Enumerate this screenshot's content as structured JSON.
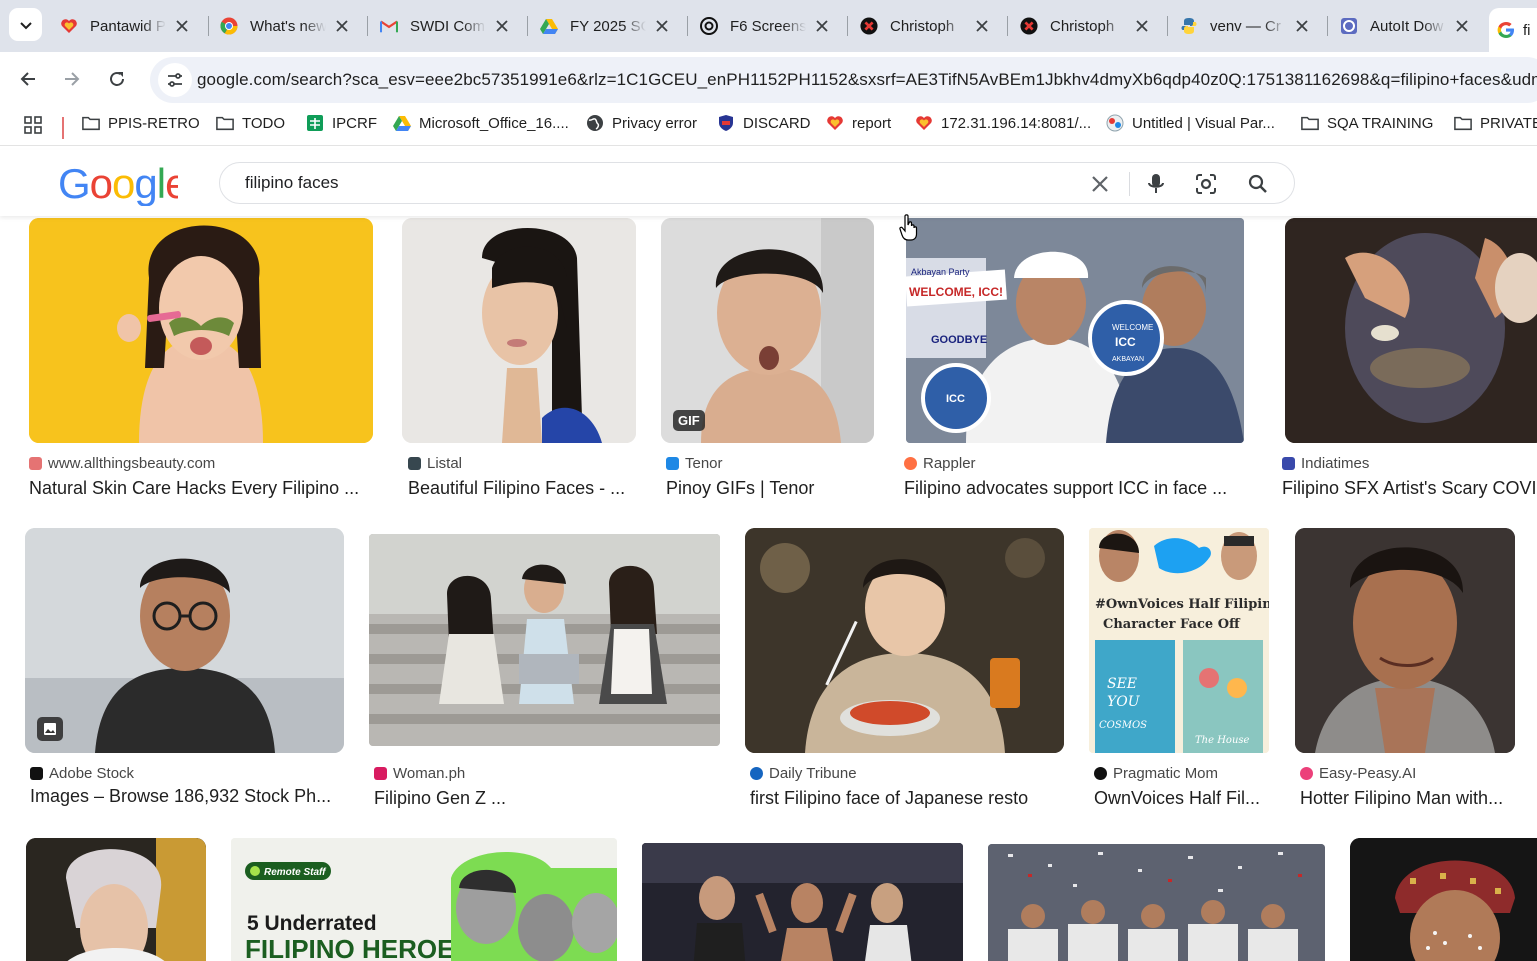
{
  "browser": {
    "tabs": [
      {
        "title": "Pantawid P",
        "favicon": "heart-icon",
        "color": "#e53935"
      },
      {
        "title": "What's new",
        "favicon": "chrome-icon",
        "color": "#4285f4"
      },
      {
        "title": "SWDI Com",
        "favicon": "gmail-icon",
        "color": "#ea4335"
      },
      {
        "title": "FY 2025 SG",
        "favicon": "drive-icon",
        "color": "#34a853"
      },
      {
        "title": "F6 Screens",
        "favicon": "openai-icon",
        "color": "#111111"
      },
      {
        "title": "Christoph",
        "favicon": "red-x-icon",
        "color": "#c62828"
      },
      {
        "title": "Christoph",
        "favicon": "red-x-icon",
        "color": "#c62828"
      },
      {
        "title": "venv — Cr",
        "favicon": "python-icon",
        "color": "#3776ab"
      },
      {
        "title": "AutoIt Dow",
        "favicon": "autoit-icon",
        "color": "#3f51b5"
      },
      {
        "title": "fi",
        "favicon": "google-icon",
        "color": "#4285f4"
      }
    ],
    "url": "google.com/search?sca_esv=eee2bc57351991e6&rlz=1C1GCEU_enPH1152PH1152&sxsrf=AE3TifN5AvBEm1Jbkhv4dmyXb6qdp40z0Q:1751381162698&q=filipino+faces&udm",
    "bookmarks": [
      {
        "label": "PPIS-RETRO",
        "icon": "folder-icon"
      },
      {
        "label": "TODO",
        "icon": "folder-icon"
      },
      {
        "label": "IPCRF",
        "icon": "sheets-icon"
      },
      {
        "label": "Microsoft_Office_16....",
        "icon": "drive-icon"
      },
      {
        "label": "Privacy error",
        "icon": "globe-icon"
      },
      {
        "label": "DISCARD",
        "icon": "shield-icon"
      },
      {
        "label": "report",
        "icon": "heart-icon"
      },
      {
        "label": "172.31.196.14:8081/...",
        "icon": "heart-icon"
      },
      {
        "label": "Untitled | Visual Par...",
        "icon": "vp-icon"
      },
      {
        "label": "SQA TRAINING",
        "icon": "folder-icon"
      },
      {
        "label": "PRIVATE",
        "icon": "folder-icon"
      }
    ]
  },
  "google": {
    "logo": "Google",
    "query": "filipino faces"
  },
  "results": [
    {
      "source": "www.allthingsbeauty.com",
      "caption": "Natural Skin Care Hacks Every Filipino ...",
      "badge": ""
    },
    {
      "source": "Listal",
      "caption": "Beautiful Filipino Faces - ...",
      "badge": ""
    },
    {
      "source": "Tenor",
      "caption": "Pinoy GIFs | Tenor",
      "badge": "GIF"
    },
    {
      "source": "Rappler",
      "caption": "Filipino advocates support ICC in face ...",
      "badge": ""
    },
    {
      "source": "Indiatimes",
      "caption": "Filipino SFX Artist's Scary COVID",
      "badge": ""
    },
    {
      "source": "Adobe Stock",
      "caption": "Images – Browse 186,932 Stock Ph...",
      "badge": "image"
    },
    {
      "source": "Woman.ph",
      "caption": "Filipino Gen Z ...",
      "badge": ""
    },
    {
      "source": "Daily Tribune",
      "caption": "first Filipino face of Japanese resto",
      "badge": ""
    },
    {
      "source": "Pragmatic Mom",
      "caption": "OwnVoices Half Fil...",
      "badge": ""
    },
    {
      "source": "Easy-Peasy.AI",
      "caption": "Hotter Filipino Man with...",
      "badge": ""
    }
  ],
  "thumb_text": {
    "rappler_sign1": "Akbayan Party",
    "rappler_sign2": "WELCOME, ICC!",
    "rappler_sign3": "GOODBYE",
    "icc_badge": "ICC",
    "icc_welcome": "WELCOME",
    "icc_akbayan": "AKBAYAN",
    "book_title": "#OwnVoices Half Filipino Character Face Off",
    "book1": "SEE YOU in the COSMOS",
    "book2": "The House",
    "remote_staff": "Remote Staff",
    "heroes_line1": "5 Underrated",
    "heroes_line2": "FILIPINO HEROES"
  }
}
